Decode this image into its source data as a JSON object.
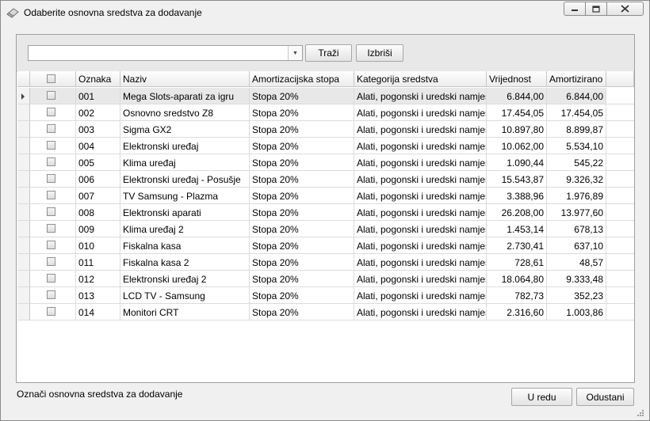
{
  "window": {
    "title": "Odaberite osnovna sredstva za dodavanje"
  },
  "toolbar": {
    "search_value": "",
    "search_label": "Traži",
    "clear_label": "Izbriši"
  },
  "grid": {
    "columns": [
      "Oznaka",
      "Naziv",
      "Amortizacijska stopa",
      "Kategorija sredstva",
      "Vrijednost",
      "Amortizirano"
    ],
    "rows": [
      {
        "oznaka": "001",
        "naziv": "Mega Slots-aparati za igru",
        "stopa": "Stopa 20%",
        "kategorija": "Alati, pogonski i uredski namješ...",
        "vrijednost": "6.844,00",
        "amortizirano": "6.844,00"
      },
      {
        "oznaka": "002",
        "naziv": "Osnovno sredstvo Z8",
        "stopa": "Stopa 20%",
        "kategorija": "Alati, pogonski i uredski namješ...",
        "vrijednost": "17.454,05",
        "amortizirano": "17.454,05"
      },
      {
        "oznaka": "003",
        "naziv": "Sigma GX2",
        "stopa": "Stopa 20%",
        "kategorija": "Alati, pogonski i uredski namješ...",
        "vrijednost": "10.897,80",
        "amortizirano": "8.899,87"
      },
      {
        "oznaka": "004",
        "naziv": "Elektronski uređaj",
        "stopa": "Stopa 20%",
        "kategorija": "Alati, pogonski i uredski namješ...",
        "vrijednost": "10.062,00",
        "amortizirano": "5.534,10"
      },
      {
        "oznaka": "005",
        "naziv": "Klima uređaj",
        "stopa": "Stopa 20%",
        "kategorija": "Alati, pogonski i uredski namješ...",
        "vrijednost": "1.090,44",
        "amortizirano": "545,22"
      },
      {
        "oznaka": "006",
        "naziv": "Elektronski uređaj - Posušje",
        "stopa": "Stopa 20%",
        "kategorija": "Alati, pogonski i uredski namješ...",
        "vrijednost": "15.543,87",
        "amortizirano": "9.326,32"
      },
      {
        "oznaka": "007",
        "naziv": "TV Samsung - Plazma",
        "stopa": "Stopa 20%",
        "kategorija": "Alati, pogonski i uredski namješ...",
        "vrijednost": "3.388,96",
        "amortizirano": "1.976,89"
      },
      {
        "oznaka": "008",
        "naziv": "Elektronski aparati",
        "stopa": "Stopa 20%",
        "kategorija": "Alati, pogonski i uredski namješ...",
        "vrijednost": "26.208,00",
        "amortizirano": "13.977,60"
      },
      {
        "oznaka": "009",
        "naziv": "Klima uređaj 2",
        "stopa": "Stopa 20%",
        "kategorija": "Alati, pogonski i uredski namješ...",
        "vrijednost": "1.453,14",
        "amortizirano": "678,13"
      },
      {
        "oznaka": "010",
        "naziv": "Fiskalna kasa",
        "stopa": "Stopa 20%",
        "kategorija": "Alati, pogonski i uredski namješ...",
        "vrijednost": "2.730,41",
        "amortizirano": "637,10"
      },
      {
        "oznaka": "011",
        "naziv": "Fiskalna kasa 2",
        "stopa": "Stopa 20%",
        "kategorija": "Alati, pogonski i uredski namješ...",
        "vrijednost": "728,61",
        "amortizirano": "48,57"
      },
      {
        "oznaka": "012",
        "naziv": "Elektronski uređaj 2",
        "stopa": "Stopa 20%",
        "kategorija": "Alati, pogonski i uredski namješ...",
        "vrijednost": "18.064,80",
        "amortizirano": "9.333,48"
      },
      {
        "oznaka": "013",
        "naziv": "LCD TV - Samsung",
        "stopa": "Stopa 20%",
        "kategorija": "Alati, pogonski i uredski namješ...",
        "vrijednost": "782,73",
        "amortizirano": "352,23"
      },
      {
        "oznaka": "014",
        "naziv": "Monitori CRT",
        "stopa": "Stopa 20%",
        "kategorija": "Alati, pogonski i uredski namješ...",
        "vrijednost": "2.316,60",
        "amortizirano": "1.003,86"
      }
    ]
  },
  "footer": {
    "hint": "Označi osnovna sredstva za dodavanje",
    "ok_label": "U redu",
    "cancel_label": "Odustani"
  }
}
